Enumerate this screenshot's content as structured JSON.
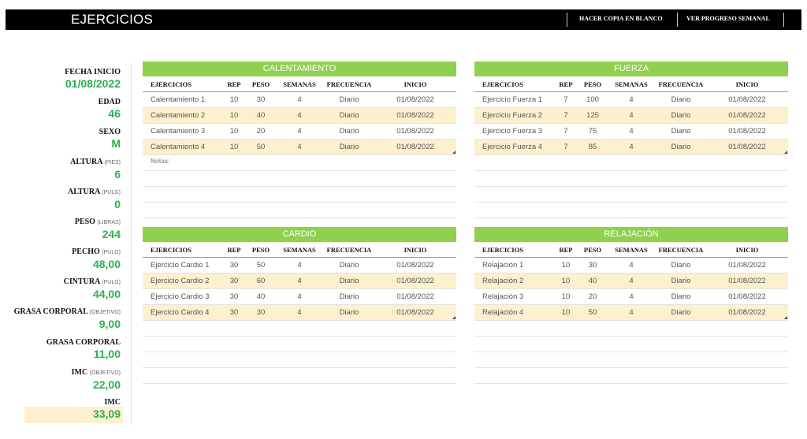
{
  "header": {
    "title": "EJERCICIOS",
    "copy_button": "HACER COPIA EN BLANCO",
    "progress_button": "VER PROGRESO SEMANAL"
  },
  "sidebar": {
    "fecha_label": "FECHA INICIO",
    "fecha_value": "01/08/2022",
    "edad_label": "EDAD",
    "edad_value": "46",
    "sexo_label": "SEXO",
    "sexo_value": "M",
    "altura_pies_label": "ALTURA",
    "altura_pies_unit": "(PIES)",
    "altura_pies_value": "6",
    "altura_pulg_label": "ALTURA",
    "altura_pulg_unit": "(PULG)",
    "altura_pulg_value": "0",
    "peso_label": "PESO",
    "peso_unit": "(LIBRAS)",
    "peso_value": "244",
    "pecho_label": "PECHO",
    "pecho_unit": "(PULG)",
    "pecho_value": "48,00",
    "cintura_label": "CINTURA",
    "cintura_unit": "(PULG)",
    "cintura_value": "44,00",
    "grasa_obj_label": "GRASA CORPORAL",
    "grasa_obj_unit": "(OBJETIVO)",
    "grasa_obj_value": "9,00",
    "grasa_label": "GRASA CORPORAL",
    "grasa_value": "11,00",
    "imc_obj_label": "IMC",
    "imc_obj_unit": "(OBJETIVO)",
    "imc_obj_value": "22,00",
    "imc_label": "IMC",
    "imc_value": "33,09"
  },
  "columns": [
    "EJERCICIOS",
    "REP",
    "PESO",
    "SEMANAS",
    "FRECUENCIA",
    "INICIO"
  ],
  "notes_label": "Notas:",
  "panels": {
    "calentamiento": {
      "title": "CALENTAMIENTO",
      "rows": [
        [
          "Calentamiento 1",
          "10",
          "30",
          "4",
          "Diario",
          "01/08/2022"
        ],
        [
          "Calentamiento 2",
          "10",
          "40",
          "4",
          "Diario",
          "01/08/2022"
        ],
        [
          "Calentamiento 3",
          "10",
          "20",
          "4",
          "Diario",
          "01/08/2022"
        ],
        [
          "Calentamiento 4",
          "10",
          "50",
          "4",
          "Diario",
          "01/08/2022"
        ]
      ]
    },
    "fuerza": {
      "title": "FUERZA",
      "rows": [
        [
          "Ejercicio Fuerza 1",
          "7",
          "100",
          "4",
          "Diario",
          "01/08/2022"
        ],
        [
          "Ejercicio Fuerza 2",
          "7",
          "125",
          "4",
          "Diario",
          "01/08/2022"
        ],
        [
          "Ejercicio Fuerza 3",
          "7",
          "75",
          "4",
          "Diario",
          "01/08/2022"
        ],
        [
          "Ejercicio Fuerza 4",
          "7",
          "85",
          "4",
          "Diario",
          "01/08/2022"
        ]
      ]
    },
    "cardio": {
      "title": "CARDIO",
      "rows": [
        [
          "Ejercicio Cardio 1",
          "30",
          "50",
          "4",
          "Diario",
          "01/08/2022"
        ],
        [
          "Ejercicio Cardio 2",
          "30",
          "60",
          "4",
          "Diario",
          "01/08/2022"
        ],
        [
          "Ejercicio Cardio 3",
          "30",
          "40",
          "4",
          "Diario",
          "01/08/2022"
        ],
        [
          "Ejercicio Cardio 4",
          "30",
          "30",
          "4",
          "Diario",
          "01/08/2022"
        ]
      ]
    },
    "relajacion": {
      "title": "RELAJACIÓN",
      "rows": [
        [
          "Relajación 1",
          "10",
          "30",
          "4",
          "Diario",
          "01/08/2022"
        ],
        [
          "Relajación 2",
          "10",
          "40",
          "4",
          "Diario",
          "01/08/2022"
        ],
        [
          "Relajación 3",
          "10",
          "20",
          "4",
          "Diario",
          "01/08/2022"
        ],
        [
          "Relajación 4",
          "10",
          "50",
          "4",
          "Diario",
          "01/08/2022"
        ]
      ]
    }
  },
  "colors": {
    "header_bg": "#000000",
    "panel_header": "#8fd14f",
    "accent_value": "#2bb14d",
    "alt_row": "#fcf0cd"
  }
}
